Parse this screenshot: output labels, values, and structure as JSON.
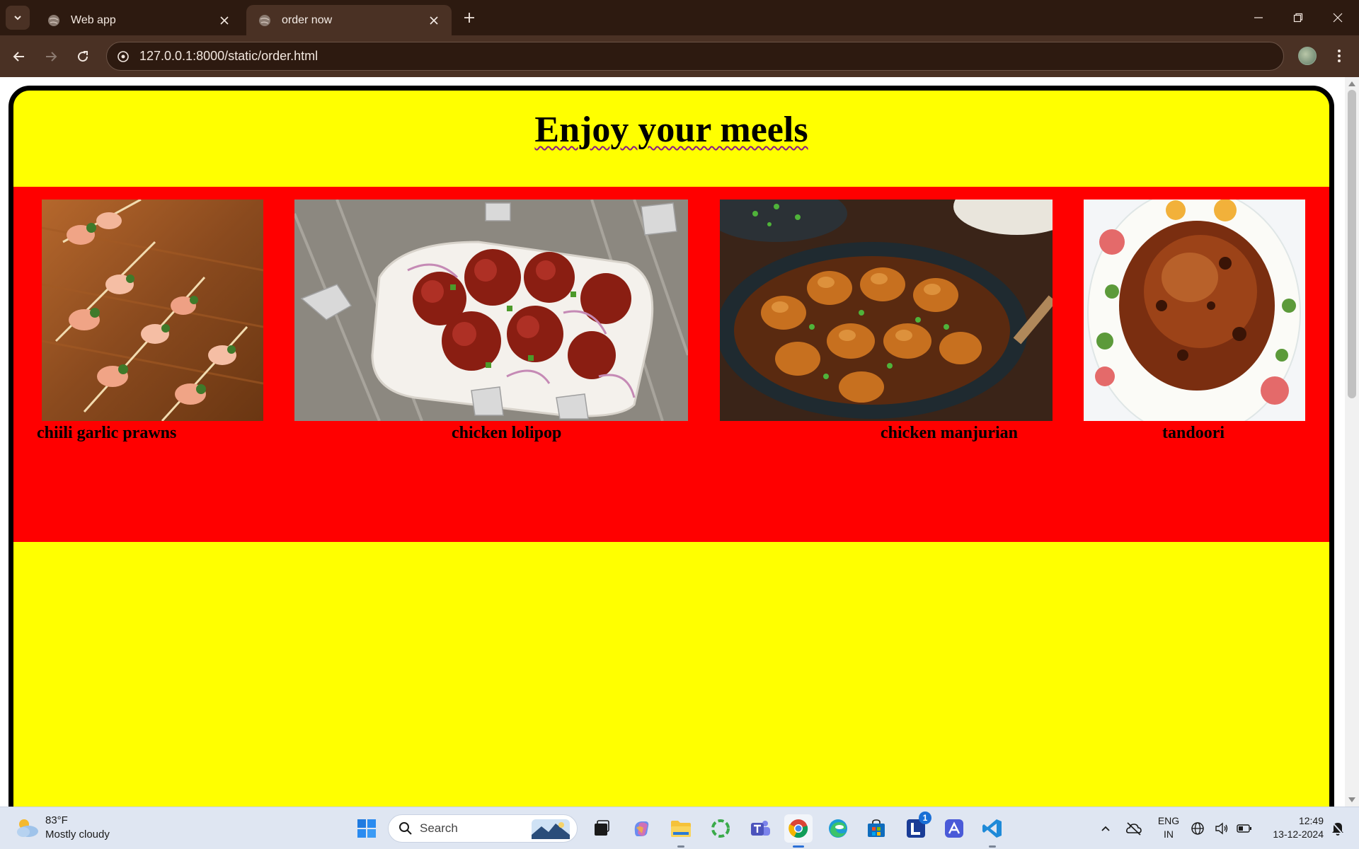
{
  "browser": {
    "tabs": [
      {
        "title": "Web app",
        "active": false
      },
      {
        "title": "order now",
        "active": true
      }
    ],
    "url": "127.0.0.1:8000/static/order.html"
  },
  "page": {
    "heading": "Enjoy your meels",
    "colors": {
      "background": "#ffff00",
      "band": "#ff0000",
      "border": "#000000"
    },
    "dishes": [
      {
        "name": "chiili garlic prawns",
        "image": "prawn skewers on wooden board"
      },
      {
        "name": "chicken lolipop",
        "image": "chicken lollipops with onions in white dish"
      },
      {
        "name": "chicken manjurian",
        "image": "chicken manchurian in black pan"
      },
      {
        "name": "tandoori",
        "image": "tandoori roast chicken on floral plate"
      }
    ]
  },
  "taskbar": {
    "weather": {
      "temp": "83°F",
      "condition": "Mostly cloudy"
    },
    "search_placeholder": "Search",
    "language": {
      "line1": "ENG",
      "line2": "IN"
    },
    "clock": {
      "time": "12:49",
      "date": "13-12-2024"
    },
    "badge_count": "1"
  }
}
